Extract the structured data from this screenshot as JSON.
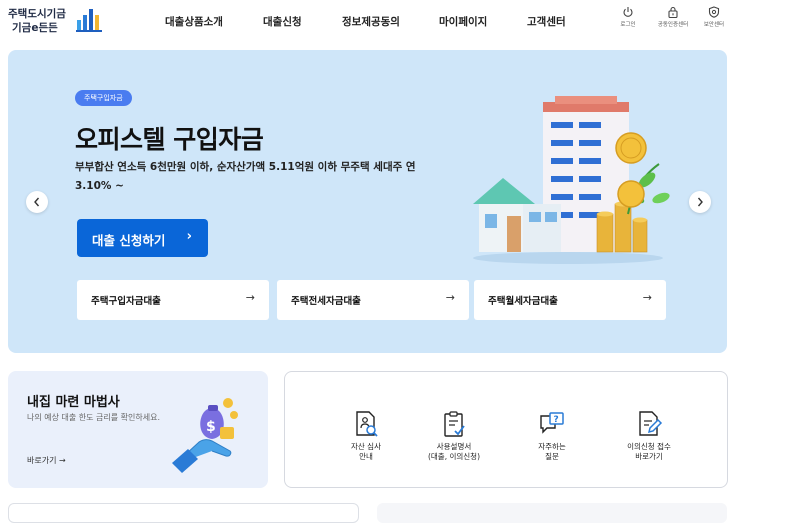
{
  "header": {
    "logo": {
      "line1": "주택도시기금",
      "line2": "기금e든든"
    },
    "nav": [
      "대출상품소개",
      "대출신청",
      "정보제공동의",
      "마이페이지",
      "고객센터"
    ],
    "utils": [
      "로그인",
      "공동인증센터",
      "보안센터"
    ]
  },
  "hero": {
    "badge": "주택구입자금",
    "title": "오피스텔 구입자금",
    "desc": "부부합산 연소득 6천만원 이하, 순자산가액 5.11억원 이하 무주택 세대주 연 3.10% ~",
    "cta": "대출 신청하기",
    "cta_arrow": "›",
    "quick": [
      {
        "label": "주택구입자금대출",
        "arrow": "→"
      },
      {
        "label": "주택전세자금대출",
        "arrow": "→"
      },
      {
        "label": "주택월세자금대출",
        "arrow": "→"
      }
    ]
  },
  "wizard": {
    "title": "내집 마련 마법사",
    "subtitle": "나의 예상 대출 한도 금리를 확인하세요.",
    "link": "바로가기 →"
  },
  "services": [
    {
      "line1": "자산 심사",
      "line2": "안내",
      "icon": "search-document-icon"
    },
    {
      "line1": "사용설명서",
      "line2": "(대출, 이의신청)",
      "icon": "checklist-icon"
    },
    {
      "line1": "자주하는",
      "line2": "질문",
      "icon": "chat-question-icon"
    },
    {
      "line1": "이의신청 접수",
      "line2": "바로가기",
      "icon": "edit-document-icon"
    }
  ],
  "colors": {
    "hero_bg": "#cfe6f9",
    "primary": "#0a66d8",
    "badge": "#4a7cf0",
    "wizard_bg": "#eaf0fb"
  }
}
